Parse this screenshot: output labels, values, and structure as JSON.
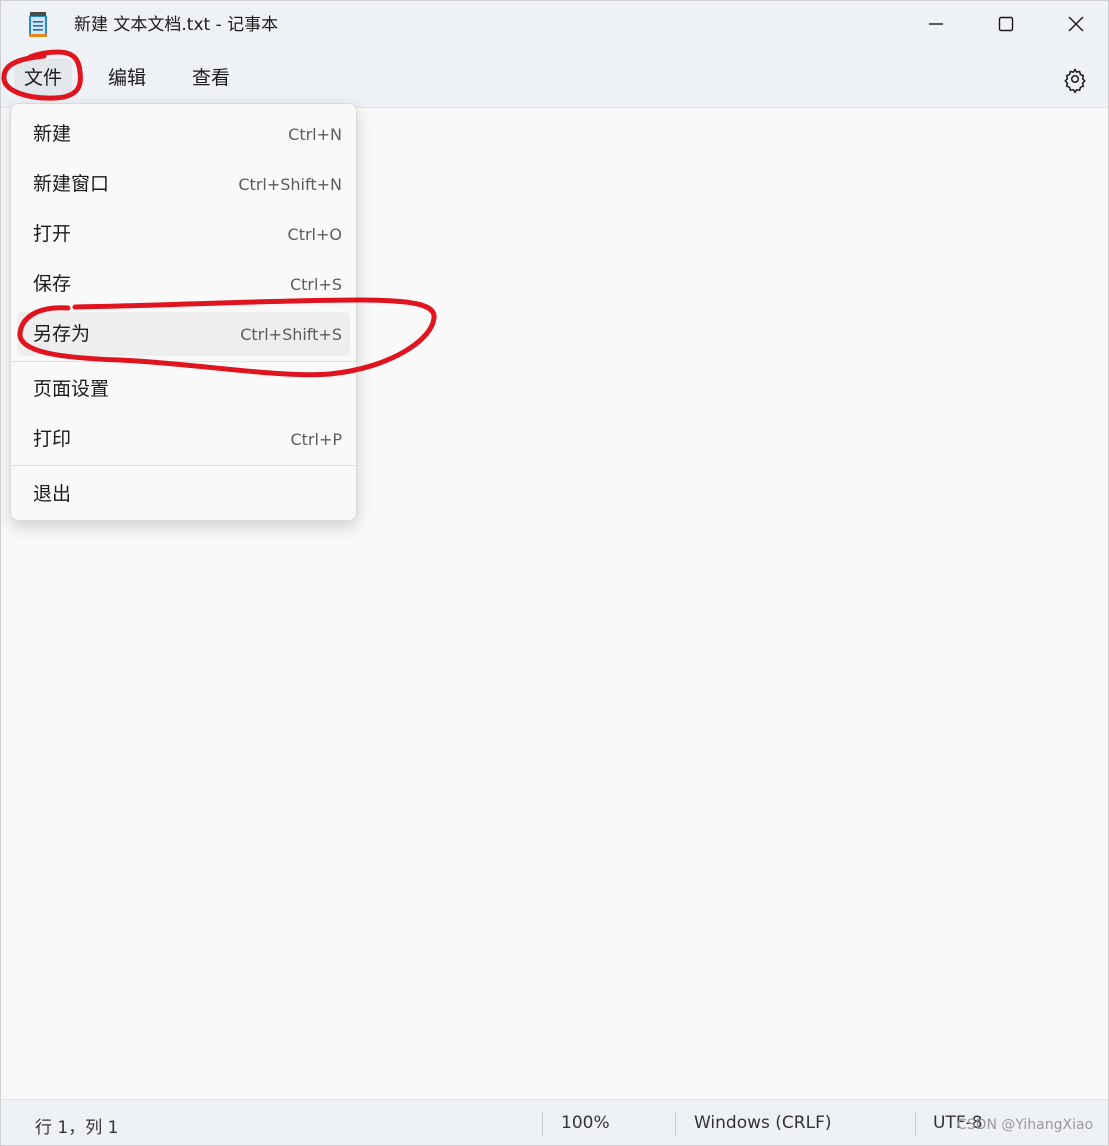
{
  "window": {
    "title": "新建 文本文档.txt - 记事本",
    "icon": "notepad-icon"
  },
  "window_controls": {
    "minimize_icon": "minimize-icon",
    "maximize_icon": "maximize-icon",
    "close_icon": "close-icon"
  },
  "menubar": {
    "file": "文件",
    "edit": "编辑",
    "view": "查看",
    "settings_icon": "gear-icon"
  },
  "file_menu": {
    "items": [
      {
        "label": "新建",
        "shortcut": "Ctrl+N"
      },
      {
        "label": "新建窗口",
        "shortcut": "Ctrl+Shift+N"
      },
      {
        "label": "打开",
        "shortcut": "Ctrl+O"
      },
      {
        "label": "保存",
        "shortcut": "Ctrl+S"
      },
      {
        "label": "另存为",
        "shortcut": "Ctrl+Shift+S"
      },
      {
        "label": "页面设置",
        "shortcut": ""
      },
      {
        "label": "打印",
        "shortcut": "Ctrl+P"
      },
      {
        "label": "退出",
        "shortcut": ""
      }
    ],
    "highlighted_item": "另存为"
  },
  "editor": {
    "content": ""
  },
  "statusbar": {
    "position": "行 1，列 1",
    "zoom": "100%",
    "line_ending": "Windows (CRLF)",
    "encoding": "UTF-8"
  },
  "watermark": "CSDN @YihangXiao",
  "colors": {
    "annotation_red": "#e0141e",
    "chrome_bg": "#eef1f6",
    "editor_bg": "#f9f9f9"
  }
}
